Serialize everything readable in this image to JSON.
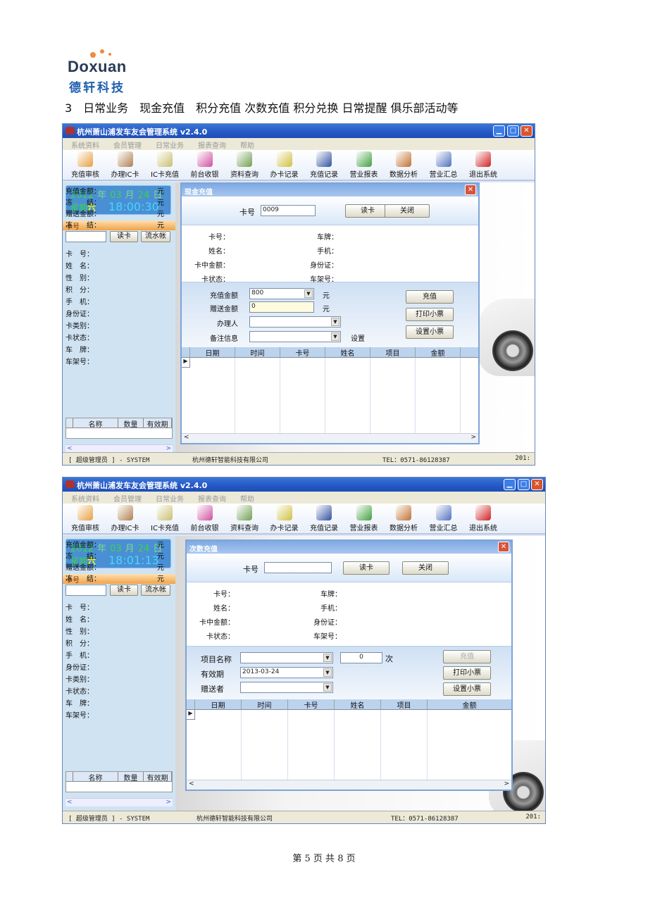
{
  "logo": {
    "brand": "Doxuan",
    "cn": "德轩科技"
  },
  "heading": "3　日常业务　现金充值　积分充值 次数充值 积分兑换 日常提醒 俱乐部活动等",
  "app": {
    "title": "杭州萧山浦发车友会管理系统 v2.4.0",
    "menu": [
      "系统资料",
      "会员管理",
      "日常业务",
      "报表查询",
      "帮助"
    ],
    "toolbar": [
      {
        "label": "充值审核",
        "icon": "audit-icon",
        "color": "#e8a040"
      },
      {
        "label": "办理IC卡",
        "icon": "card-box-icon",
        "color": "#b08050"
      },
      {
        "label": "IC卡充值",
        "icon": "pen-card-icon",
        "color": "#c8c070"
      },
      {
        "label": "前台收银",
        "icon": "palette-icon",
        "color": "#d050a0"
      },
      {
        "label": "资料查询",
        "icon": "binoculars-icon",
        "color": "#70a050"
      },
      {
        "label": "办卡记录",
        "icon": "record-icon",
        "color": "#d0c040"
      },
      {
        "label": "充值记录",
        "icon": "books-icon",
        "color": "#3050a0"
      },
      {
        "label": "营业报表",
        "icon": "bar-chart-icon",
        "color": "#40a040"
      },
      {
        "label": "数据分析",
        "icon": "analysis-icon",
        "color": "#c07030"
      },
      {
        "label": "营业汇总",
        "icon": "summary-icon",
        "color": "#5070c0"
      },
      {
        "label": "退出系统",
        "icon": "exit-icon",
        "color": "#d02020"
      }
    ],
    "left": {
      "date_units": {
        "year": "年",
        "month": "月",
        "day": "日",
        "weekday": "星期"
      },
      "card_header": "卡号",
      "read_btn": "读卡",
      "ledger_btn": "流水帐",
      "fields": [
        "卡　号：",
        "姓　名：",
        "性　别：",
        "积　分：",
        "手　机：",
        "身份证：",
        "卡类别：",
        "卡状态：",
        "车　牌：",
        "车架号："
      ],
      "money": [
        {
          "label": "充值金额：",
          "unit": "元"
        },
        {
          "label": "冻　　结：",
          "unit": "元"
        },
        {
          "label": "赠送金额：",
          "unit": "元"
        },
        {
          "label": "冻　　结：",
          "unit": "元"
        }
      ],
      "grid_cols": [
        "名称",
        "数量",
        "有效期"
      ]
    },
    "status": {
      "user": "[ 超级管理员 ] - SYSTEM",
      "company": "杭州德轩智能科技有限公司",
      "tel": "TEL：0571-86128387",
      "date": "201:"
    }
  },
  "windows": [
    {
      "clock": {
        "year": "2012",
        "month": "03",
        "day": "24",
        "weekday": "六",
        "time": "18:00:30"
      },
      "dialog": {
        "title": "现金充值",
        "card_label": "卡号",
        "card_value": "0009",
        "read_btn": "读卡",
        "close_btn": "关闭",
        "info_left": [
          "卡号：",
          "姓名：",
          "卡中金额：",
          "卡状态："
        ],
        "info_right": [
          "车牌：",
          "手机：",
          "身份证：",
          "车架号："
        ],
        "form": {
          "amount_label": "充值金额",
          "amount_value": "800",
          "amount_unit": "元",
          "bonus_label": "赠送金额",
          "bonus_value": "0",
          "bonus_unit": "元",
          "handler_label": "办理人",
          "handler_value": "",
          "remark_label": "备注信息",
          "remark_value": "",
          "remark_setting": "设置"
        },
        "buttons": [
          "充值",
          "打印小票",
          "设置小票"
        ],
        "columns": [
          "日期",
          "时间",
          "卡号",
          "姓名",
          "项目",
          "金额"
        ]
      }
    },
    {
      "clock": {
        "year": "2012",
        "month": "03",
        "day": "24",
        "weekday": "六",
        "time": "18:01:13"
      },
      "dialog": {
        "title": "次数充值",
        "card_label": "卡号",
        "card_value": "",
        "read_btn": "读卡",
        "close_btn": "关闭",
        "info_left": [
          "卡号：",
          "姓名：",
          "卡中金额：",
          "卡状态："
        ],
        "info_right": [
          "车牌：",
          "手机：",
          "身份证：",
          "车架号："
        ],
        "form": {
          "item_label": "项目名称",
          "item_value": "",
          "count_value": "0",
          "count_unit": "次",
          "expiry_label": "有效期",
          "expiry_value": "2013-03-24",
          "giver_label": "赠送者",
          "giver_value": ""
        },
        "buttons": [
          "充值",
          "打印小票",
          "设置小票"
        ],
        "charge_disabled": true,
        "columns": [
          "日期",
          "时间",
          "卡号",
          "姓名",
          "项目",
          "金额"
        ]
      }
    }
  ],
  "footer": "第 5 页 共 8 页"
}
